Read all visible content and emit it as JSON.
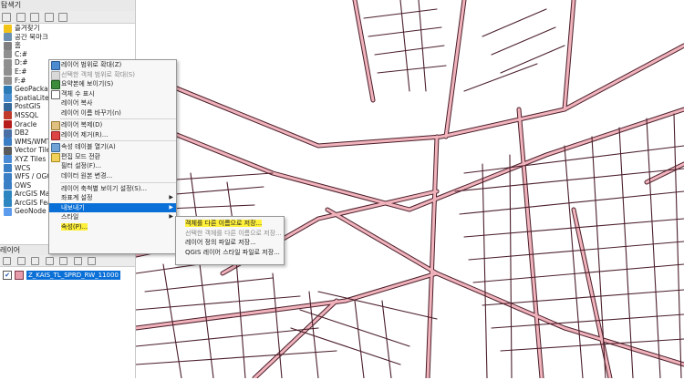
{
  "browser_panel": {
    "title": "탐색기",
    "items": [
      {
        "label": "즐겨찾기",
        "color": "#f2c418"
      },
      {
        "label": "공간 북마크",
        "color": "#6a8fb0"
      },
      {
        "label": "홈",
        "color": "#7f7f7f"
      },
      {
        "label": "C:#",
        "color": "#8f8f8f"
      },
      {
        "label": "D:#",
        "color": "#8f8f8f"
      },
      {
        "label": "E:#",
        "color": "#8f8f8f"
      },
      {
        "label": "F:#",
        "color": "#8f8f8f"
      },
      {
        "label": "GeoPackage",
        "color": "#2c7bb6"
      },
      {
        "label": "SpatiaLite",
        "color": "#4a8fd0"
      },
      {
        "label": "PostGIS",
        "color": "#34679a"
      },
      {
        "label": "MSSQL",
        "color": "#c0392b"
      },
      {
        "label": "Oracle",
        "color": "#b71c1c"
      },
      {
        "label": "DB2",
        "color": "#4a6fa5"
      },
      {
        "label": "WMS/WMTS",
        "color": "#3a7ec6"
      },
      {
        "label": "Vector Tiles",
        "color": "#5a5a5a"
      },
      {
        "label": "XYZ Tiles",
        "color": "#4b8bd6"
      },
      {
        "label": "WCS",
        "color": "#3a7ec6"
      },
      {
        "label": "WFS / OGC A",
        "color": "#3a7ec6"
      },
      {
        "label": "OWS",
        "color": "#3a7ec6"
      },
      {
        "label": "ArcGIS Map S",
        "color": "#2e86c1"
      },
      {
        "label": "ArcGIS Featu",
        "color": "#2e86c1"
      },
      {
        "label": "GeoNode",
        "color": "#5d9cec"
      }
    ]
  },
  "layers_panel": {
    "title": "레이어",
    "layer_name": "Z_KAIS_TL_SPRD_RW_11000",
    "checked": "✔"
  },
  "context_menu": {
    "items": [
      {
        "label": "레이어 범위로 확대(Z)",
        "disabled": false
      },
      {
        "label": "선택한 객체 범위로 확대(S)",
        "disabled": true
      },
      {
        "label": "요약본에 보이기(S)",
        "disabled": false
      },
      {
        "label": "객체 수 표시",
        "disabled": false
      },
      {
        "label": "레이어 복사",
        "disabled": false
      },
      {
        "label": "레이어 이름 바꾸기(n)",
        "disabled": false
      },
      {
        "label": "레이어 복제(D)",
        "disabled": false,
        "sep_before": true
      },
      {
        "label": "레이어 제거(R)...",
        "disabled": false
      },
      {
        "label": "속성 테이블 열기(A)",
        "disabled": false,
        "sep_before": true
      },
      {
        "label": "편집 모드 전환",
        "disabled": false
      },
      {
        "label": "필터 설정(F)...",
        "disabled": false
      },
      {
        "label": "데이터 원본 변경...",
        "disabled": false
      },
      {
        "label": "레이어 축척별 보이기 설정(S)...",
        "disabled": false,
        "sep_before": true
      },
      {
        "label": "좌표계 설정",
        "disabled": false,
        "submenu": true
      },
      {
        "label": "내보내기",
        "disabled": false,
        "submenu": true,
        "selected": true,
        "sep_before": true
      },
      {
        "label": "스타일",
        "disabled": false,
        "submenu": true,
        "sep_before": true
      },
      {
        "label": "속성(P)...",
        "disabled": false,
        "highlighted": true
      }
    ]
  },
  "export_submenu": {
    "items": [
      {
        "label": "객체를 다른 이름으로 저장...",
        "highlighted": true,
        "disabled": false
      },
      {
        "label": "선택한 객체를 다른 이름으로 저장...",
        "disabled": true
      },
      {
        "label": "레이어 정의 파일로 저장...",
        "disabled": false
      },
      {
        "label": "QGIS 레이어 스타일 파일로 저장...",
        "disabled": false
      }
    ]
  },
  "colors": {
    "road_fill": "#f0b3bc",
    "road_edge": "#4a1e2a",
    "selection": "#0a6fd6",
    "highlight": "#fff03a"
  }
}
